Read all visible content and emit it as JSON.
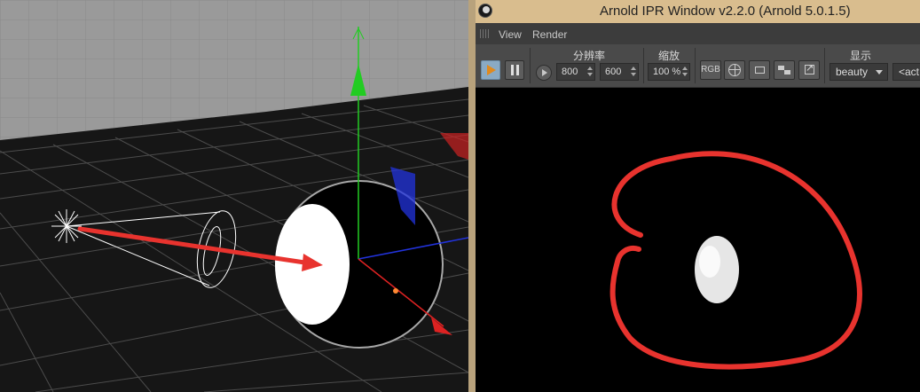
{
  "ipr_window": {
    "title": "Arnold IPR Window v2.2.0 (Arnold 5.0.1.5)",
    "app_icon": "cinema4d-icon"
  },
  "menu": {
    "items": [
      "View",
      "Render"
    ]
  },
  "toolbar": {
    "play_icon": "play-icon",
    "pause_icon": "pause-icon",
    "resolution_label": "分辨率",
    "resolution_width": "800",
    "resolution_height": "600",
    "zoom_label": "缩放",
    "zoom_value": "100 %",
    "rgb_label": "RGB",
    "display_label": "显示",
    "aov_value": "beauty",
    "second_dropdown_value": "<act"
  },
  "colors": {
    "annotation_red": "#e8332e",
    "title_bar": "#d9bd8e",
    "play_accent": "#e08a1e",
    "gizmo_y_axis": "#22cc22",
    "gizmo_z_axis": "#2233dd"
  }
}
